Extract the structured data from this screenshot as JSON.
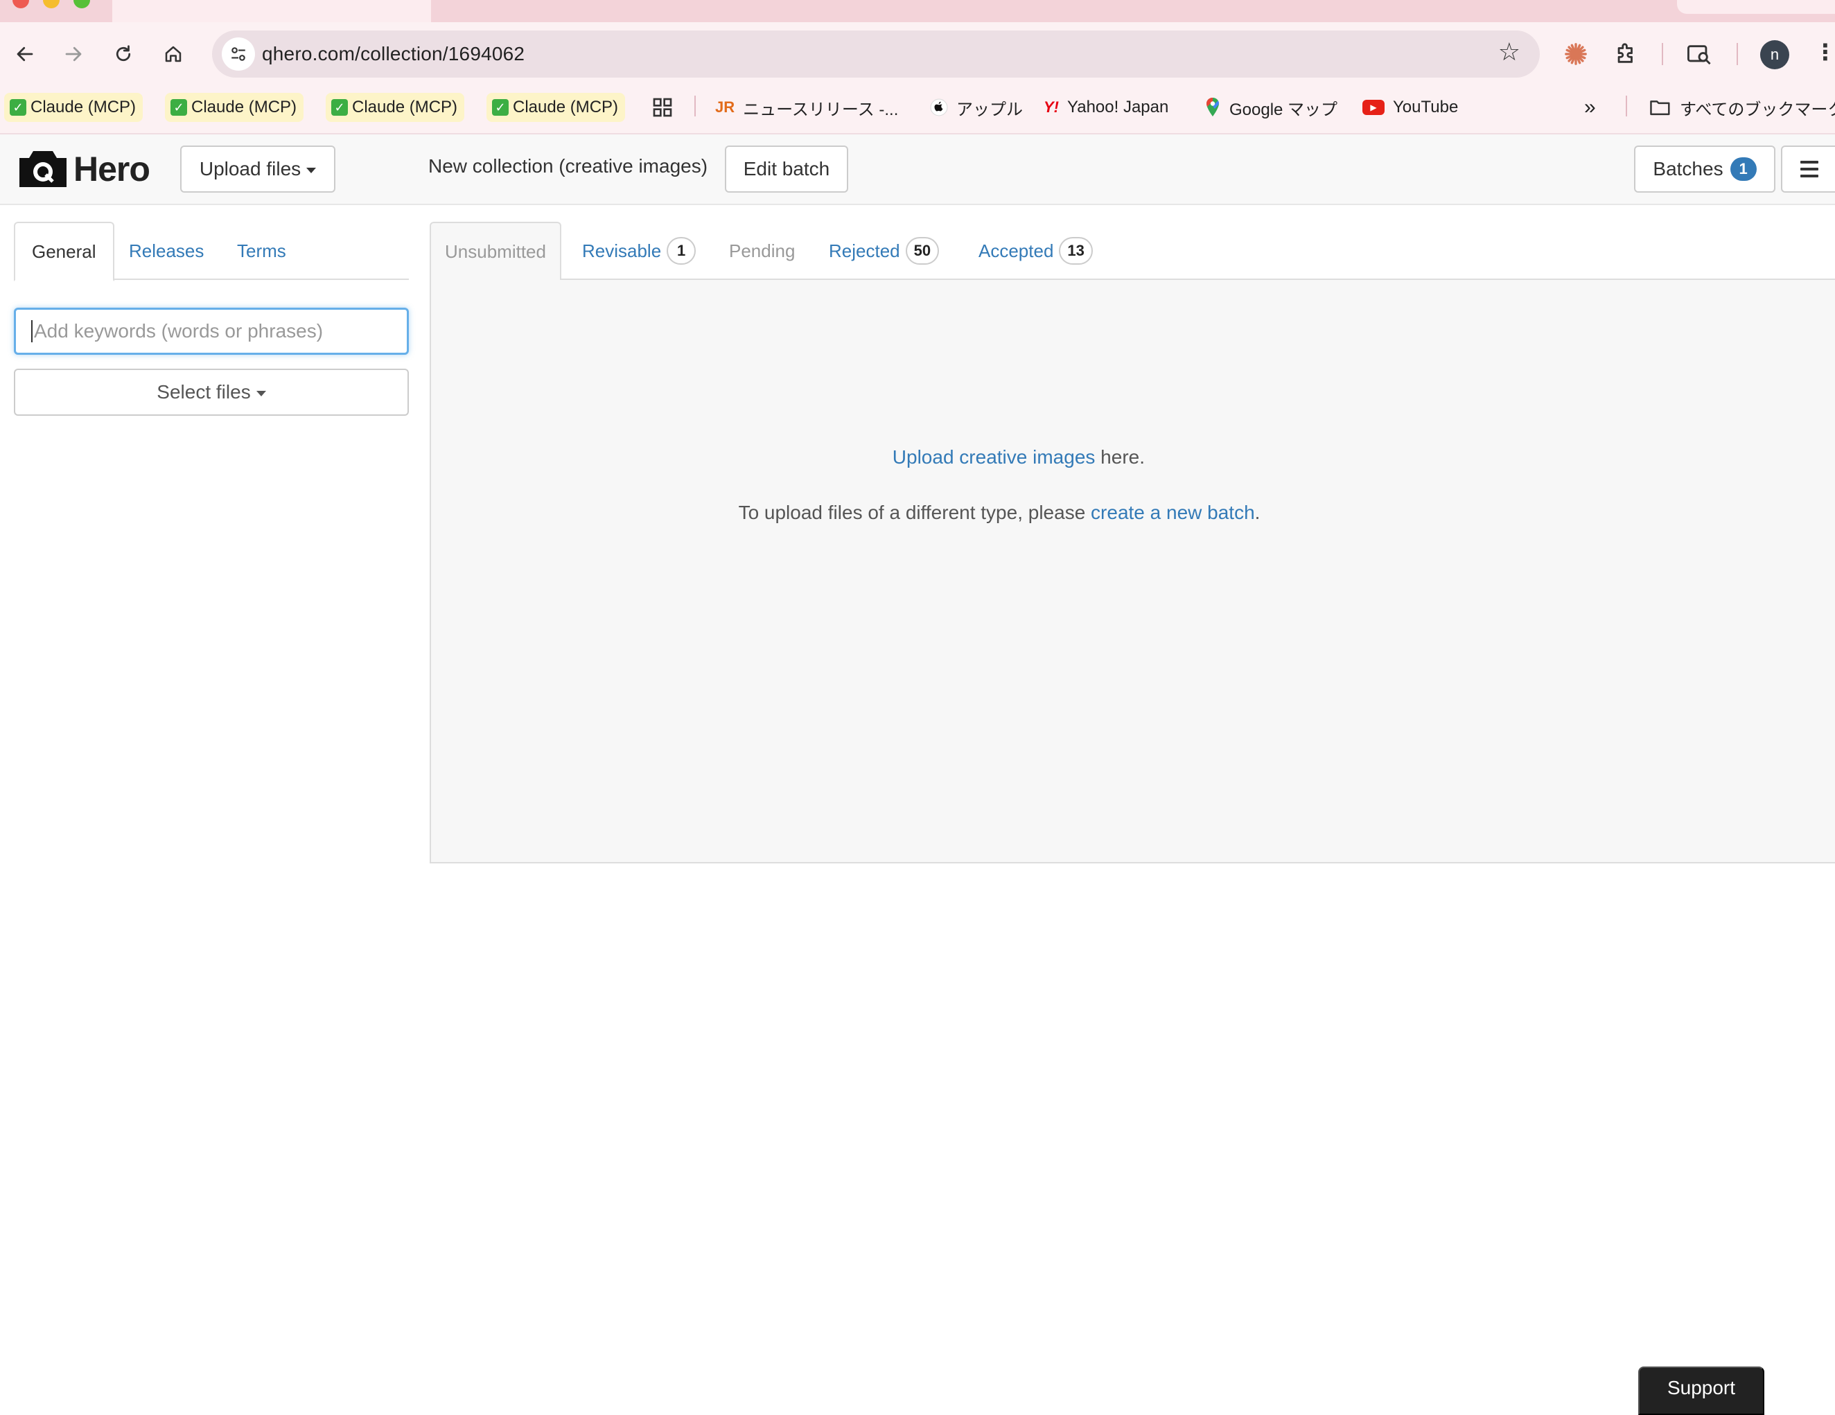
{
  "browser": {
    "url": "qhero.com/collection/1694062",
    "bookmarks": [
      {
        "label": "Claude (MCP)"
      },
      {
        "label": "Claude (MCP)"
      },
      {
        "label": "Claude (MCP)"
      },
      {
        "label": "Claude (MCP)"
      },
      {
        "label": "ニュースリリース -..."
      },
      {
        "label": "アップル"
      },
      {
        "label": "Yahoo! Japan"
      },
      {
        "label": "Google マップ"
      },
      {
        "label": "YouTube"
      },
      {
        "label": "すべてのブックマーク"
      }
    ],
    "avatar_letter": "n",
    "more_bookmarks": "»"
  },
  "header": {
    "logo_text": "Hero",
    "upload_files_label": "Upload files",
    "collection_title": "New collection (creative images)",
    "edit_batch_label": "Edit batch",
    "batches_label": "Batches",
    "batches_count": "1"
  },
  "left_panel": {
    "tabs": [
      {
        "label": "General"
      },
      {
        "label": "Releases"
      },
      {
        "label": "Terms"
      }
    ],
    "keywords_placeholder": "Add keywords (words or phrases)",
    "select_files_label": "Select files"
  },
  "status_tabs": [
    {
      "label": "Unsubmitted",
      "count": ""
    },
    {
      "label": "Revisable",
      "count": "1"
    },
    {
      "label": "Pending",
      "count": ""
    },
    {
      "label": "Rejected",
      "count": "50"
    },
    {
      "label": "Accepted",
      "count": "13"
    }
  ],
  "content": {
    "upload_link": "Upload creative images",
    "upload_suffix": " here.",
    "different_type_prefix": "To upload files of a different type, please ",
    "new_batch_link": "create a new batch",
    "different_type_suffix": "."
  },
  "support_label": "Support",
  "colors": {
    "link": "#337ab7",
    "badge": "#337ab7",
    "tabstrip": "#f3d3d9",
    "toolbar": "#fcf1f3"
  }
}
